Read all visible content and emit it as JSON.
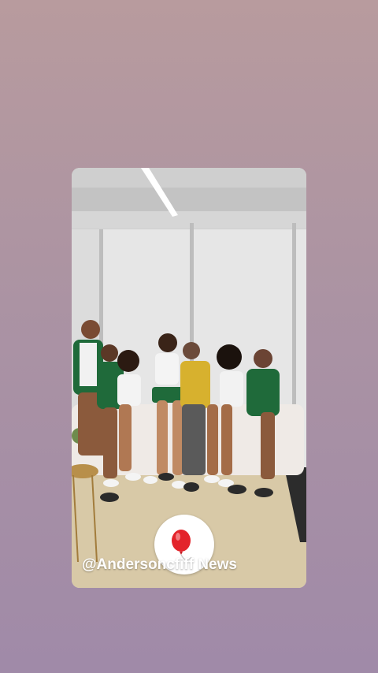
{
  "story": {
    "mention_text": "@Andersoncfiff News",
    "sticker_icon": "balloon-icon",
    "sticker_color": "#e3242b",
    "background_top": "#b89b9e",
    "background_bottom": "#a08aa8"
  }
}
